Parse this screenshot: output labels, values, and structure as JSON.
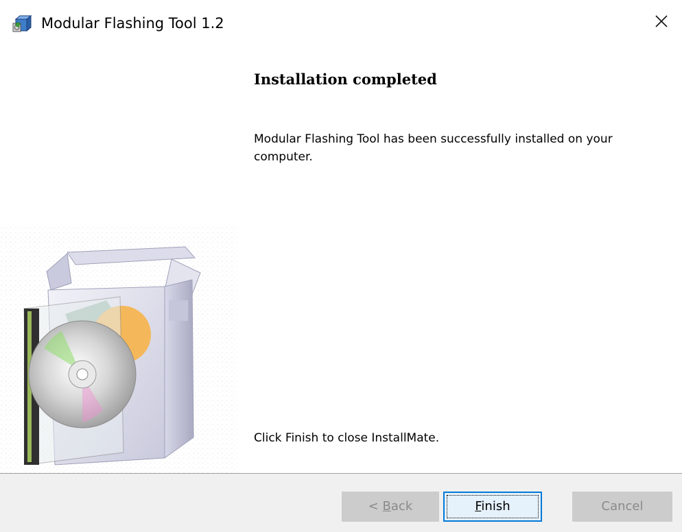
{
  "window": {
    "title": "Modular Flashing Tool 1.2",
    "close_glyph": "✕"
  },
  "content": {
    "heading": "Installation completed",
    "message": "Modular Flashing Tool has been successfully installed on your computer.",
    "footer_message": "Click Finish to close InstallMate."
  },
  "buttons": {
    "back": {
      "prefix": "< ",
      "accel": "B",
      "rest": "ack",
      "enabled": false
    },
    "finish": {
      "accel": "F",
      "rest": "inish",
      "enabled": true,
      "focused": true
    },
    "cancel": {
      "label": "Cancel",
      "enabled": false
    }
  },
  "icons": {
    "app": "installer-box-icon",
    "close": "close-icon",
    "art": "software-box-cd-illustration"
  },
  "colors": {
    "focus_border": "#0078d7",
    "button_bg_disabled": "#cccccc",
    "bottom_bar": "#f0f0f0"
  }
}
